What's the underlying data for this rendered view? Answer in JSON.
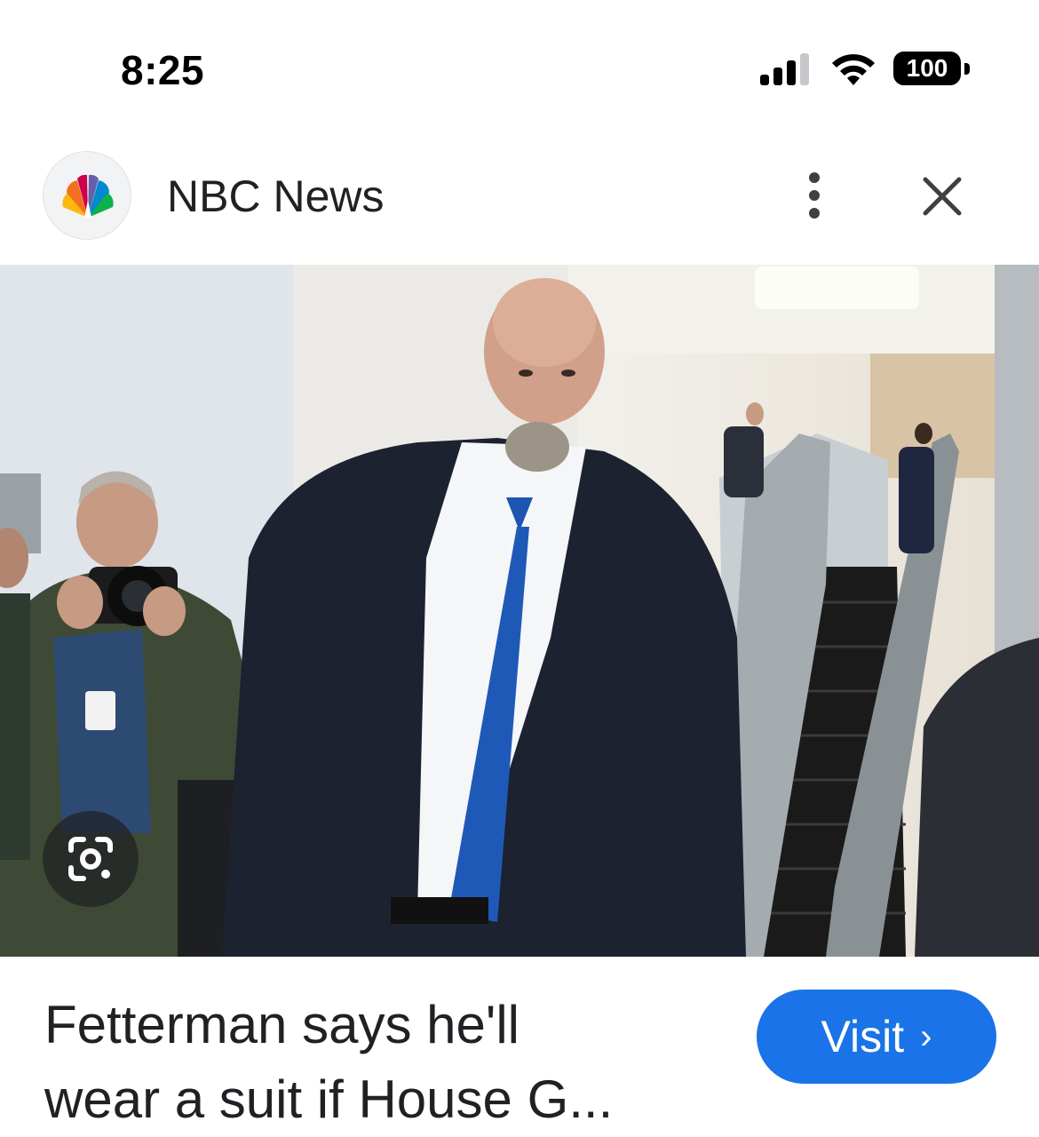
{
  "status_bar": {
    "time": "8:25",
    "battery_level": "100",
    "signal_bars_filled": 3,
    "signal_bars_total": 4
  },
  "header": {
    "source_name": "NBC News",
    "logo_icon": "nbc-peacock-icon",
    "more_icon": "more-vert-icon",
    "close_icon": "close-icon"
  },
  "image": {
    "lens_icon": "google-lens-icon"
  },
  "article": {
    "headline_line1": "Fetterman says he'll",
    "headline_line2": "wear a suit if House G..."
  },
  "actions": {
    "visit_label": "Visit",
    "visit_chevron": "›",
    "accent_color": "#1a73e8"
  }
}
